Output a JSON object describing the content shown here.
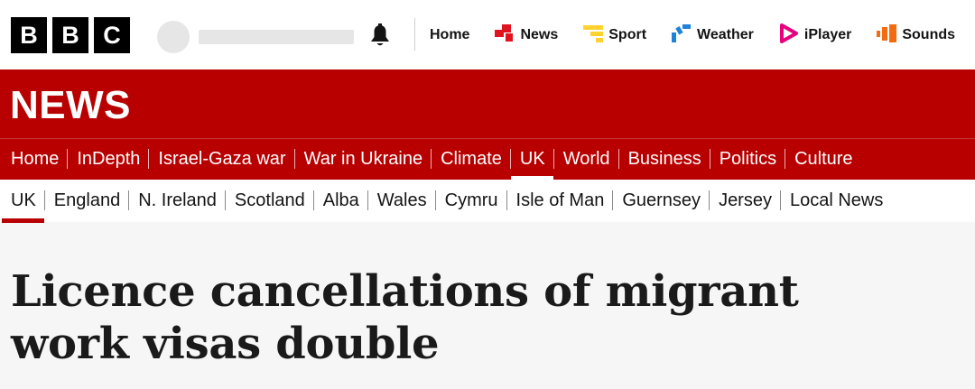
{
  "brand": {
    "letters": [
      "B",
      "B",
      "C"
    ]
  },
  "top_nav": [
    {
      "label": "Home",
      "icon": "none"
    },
    {
      "label": "News",
      "icon": "news-icon",
      "color": "#e0141e"
    },
    {
      "label": "Sport",
      "icon": "sport-icon",
      "color": "#ffd230"
    },
    {
      "label": "Weather",
      "icon": "weather-icon",
      "color": "#1e82dc"
    },
    {
      "label": "iPlayer",
      "icon": "iplayer-icon",
      "color": "#e6007e"
    },
    {
      "label": "Sounds",
      "icon": "sounds-icon",
      "color": "#f46c12"
    }
  ],
  "section_title": "NEWS",
  "primary_nav": [
    {
      "label": "Home"
    },
    {
      "label": "InDepth"
    },
    {
      "label": "Israel-Gaza war"
    },
    {
      "label": "War in Ukraine"
    },
    {
      "label": "Climate"
    },
    {
      "label": "UK",
      "active": true
    },
    {
      "label": "World"
    },
    {
      "label": "Business"
    },
    {
      "label": "Politics"
    },
    {
      "label": "Culture"
    }
  ],
  "secondary_nav": [
    {
      "label": "UK",
      "active": true
    },
    {
      "label": "England"
    },
    {
      "label": "N. Ireland"
    },
    {
      "label": "Scotland"
    },
    {
      "label": "Alba"
    },
    {
      "label": "Wales"
    },
    {
      "label": "Cymru"
    },
    {
      "label": "Isle of Man"
    },
    {
      "label": "Guernsey"
    },
    {
      "label": "Jersey"
    },
    {
      "label": "Local News"
    }
  ],
  "article": {
    "headline_line1": "Licence cancellations of migrant",
    "headline_line2": "work visas double"
  },
  "colors": {
    "brand_red": "#b80000",
    "page_bg": "#f6f6f6"
  }
}
